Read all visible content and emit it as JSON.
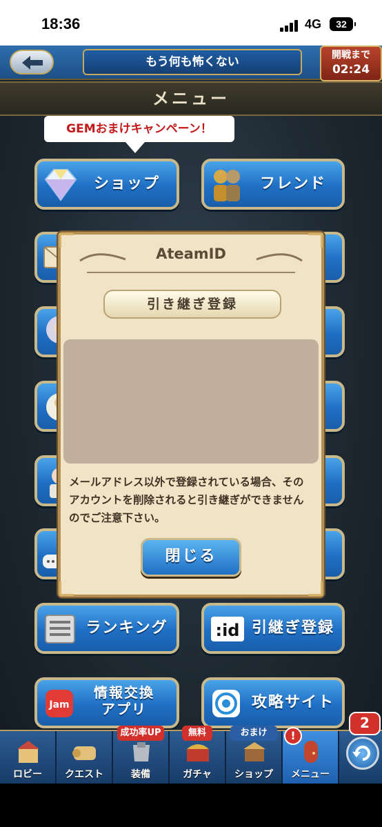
{
  "status_bar": {
    "time": "18:36",
    "network": "4G",
    "battery": "32"
  },
  "header": {
    "title": "もう何も怖くない",
    "timer_label": "開戦まで",
    "timer_value": "02:24"
  },
  "page": {
    "heading": "メニュー"
  },
  "campaign": {
    "text": "GEMおまけキャンペーン！"
  },
  "menu": {
    "shop": "ショップ",
    "friend": "フレンド",
    "ranking": "ランキング",
    "transfer": "引継ぎ登録",
    "info_app_line1": "情報交換",
    "info_app_line2": "アプリ",
    "strategy_site": "攻略サイト",
    "jam_icon": "Jam",
    "id_icon": ":id"
  },
  "dialog": {
    "title": "AteamID",
    "register_button": "引き継ぎ登録",
    "notice": "メールアドレス以外で登録されている場合、そのアカウントを削除されると引き継ぎができませんのでご注意下さい。",
    "close_button": "閉じる"
  },
  "tabs": {
    "lobby": "ロビー",
    "quest": "クエスト",
    "equipment": "装備",
    "gacha": "ガチャ",
    "shop": "ショップ",
    "menu": "メニュー",
    "badge_success": "成功率UP",
    "badge_free": "無料",
    "badge_bonus": "おまけ",
    "notification_count": "2",
    "menu_alert": "!"
  }
}
